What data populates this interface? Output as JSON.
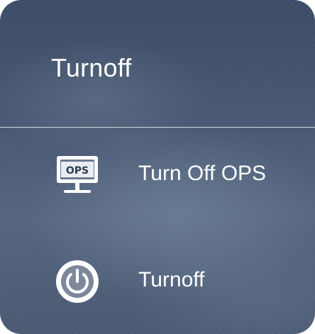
{
  "dialog": {
    "title": "Turnoff",
    "items": [
      {
        "label": "Turn Off OPS",
        "icon": "monitor-ops-icon",
        "icon_text": "OPS"
      },
      {
        "label": "Turnoff",
        "icon": "power-icon"
      }
    ]
  },
  "colors": {
    "text": "#ffffff",
    "background": "#4a5a74",
    "divider": "#c8ced8"
  }
}
